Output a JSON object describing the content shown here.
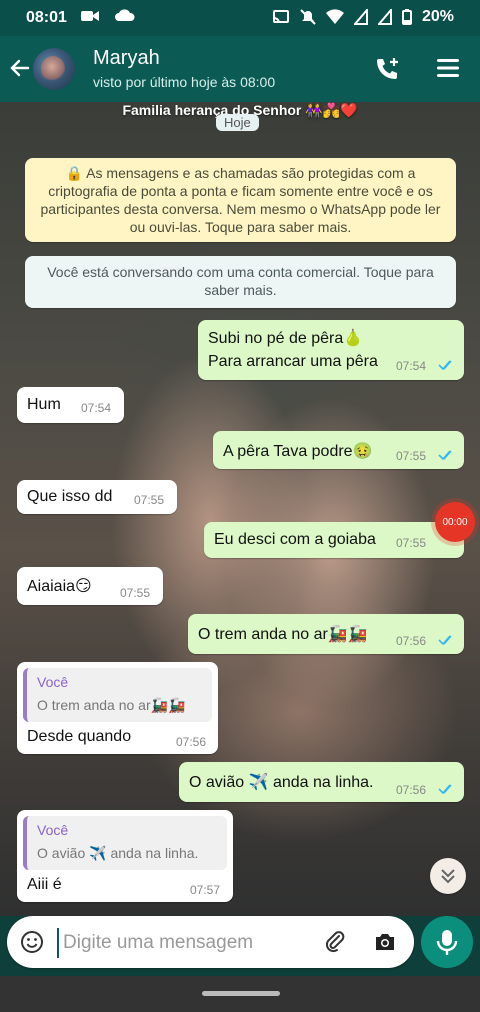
{
  "status_bar": {
    "time": "08:01",
    "battery": "20%"
  },
  "header": {
    "contact_name": "Maryah",
    "last_seen": "visto por último hoje às 08:00"
  },
  "chat": {
    "group_label": "Familia herança do Senhor 👭💏❤️",
    "date_pill": "Hoje",
    "encryption_notice": "🔒 As mensagens e as chamadas são protegidas com a criptografia de ponta a ponta e ficam somente entre você e os participantes desta conversa. Nem mesmo o WhatsApp pode ler ou ouvi-las. Toque para saber mais.",
    "business_notice": "Você está conversando com uma conta comercial. Toque para saber mais.",
    "messages": [
      {
        "line1": "Subi no pé de pêra🍐",
        "line2": "Para arrancar uma pêra",
        "time": "07:54"
      },
      {
        "text": "Hum",
        "time": "07:54"
      },
      {
        "text": "A pêra Tava podre🤢",
        "time": "07:55"
      },
      {
        "text": "Que isso dd",
        "time": "07:55"
      },
      {
        "text": "Eu desci com a goiaba",
        "time": "07:55"
      },
      {
        "text": "Aiaiaia😏",
        "time": "07:55"
      },
      {
        "text": "O trem anda no ar🚂🚂",
        "time": "07:56"
      },
      {
        "quote_author": "Você",
        "quote_text": "O trem anda no ar🚂🚂",
        "text": "Desde  quando",
        "time": "07:56"
      },
      {
        "text": "O avião ✈️  anda na linha.",
        "time": "07:56"
      },
      {
        "quote_author": "Você",
        "quote_text": "O avião ✈️  anda na linha.",
        "text": "Aiii é",
        "time": "07:57"
      }
    ],
    "recording_timer": "00:00"
  },
  "input": {
    "placeholder": "Digite uma mensagem"
  },
  "colors": {
    "header": "#0b5a54",
    "outgoing_bubble": "#dcf8c6",
    "incoming_bubble": "#ffffff",
    "mic_button": "#0b8f7c",
    "read_ticks": "#34b7f1"
  }
}
